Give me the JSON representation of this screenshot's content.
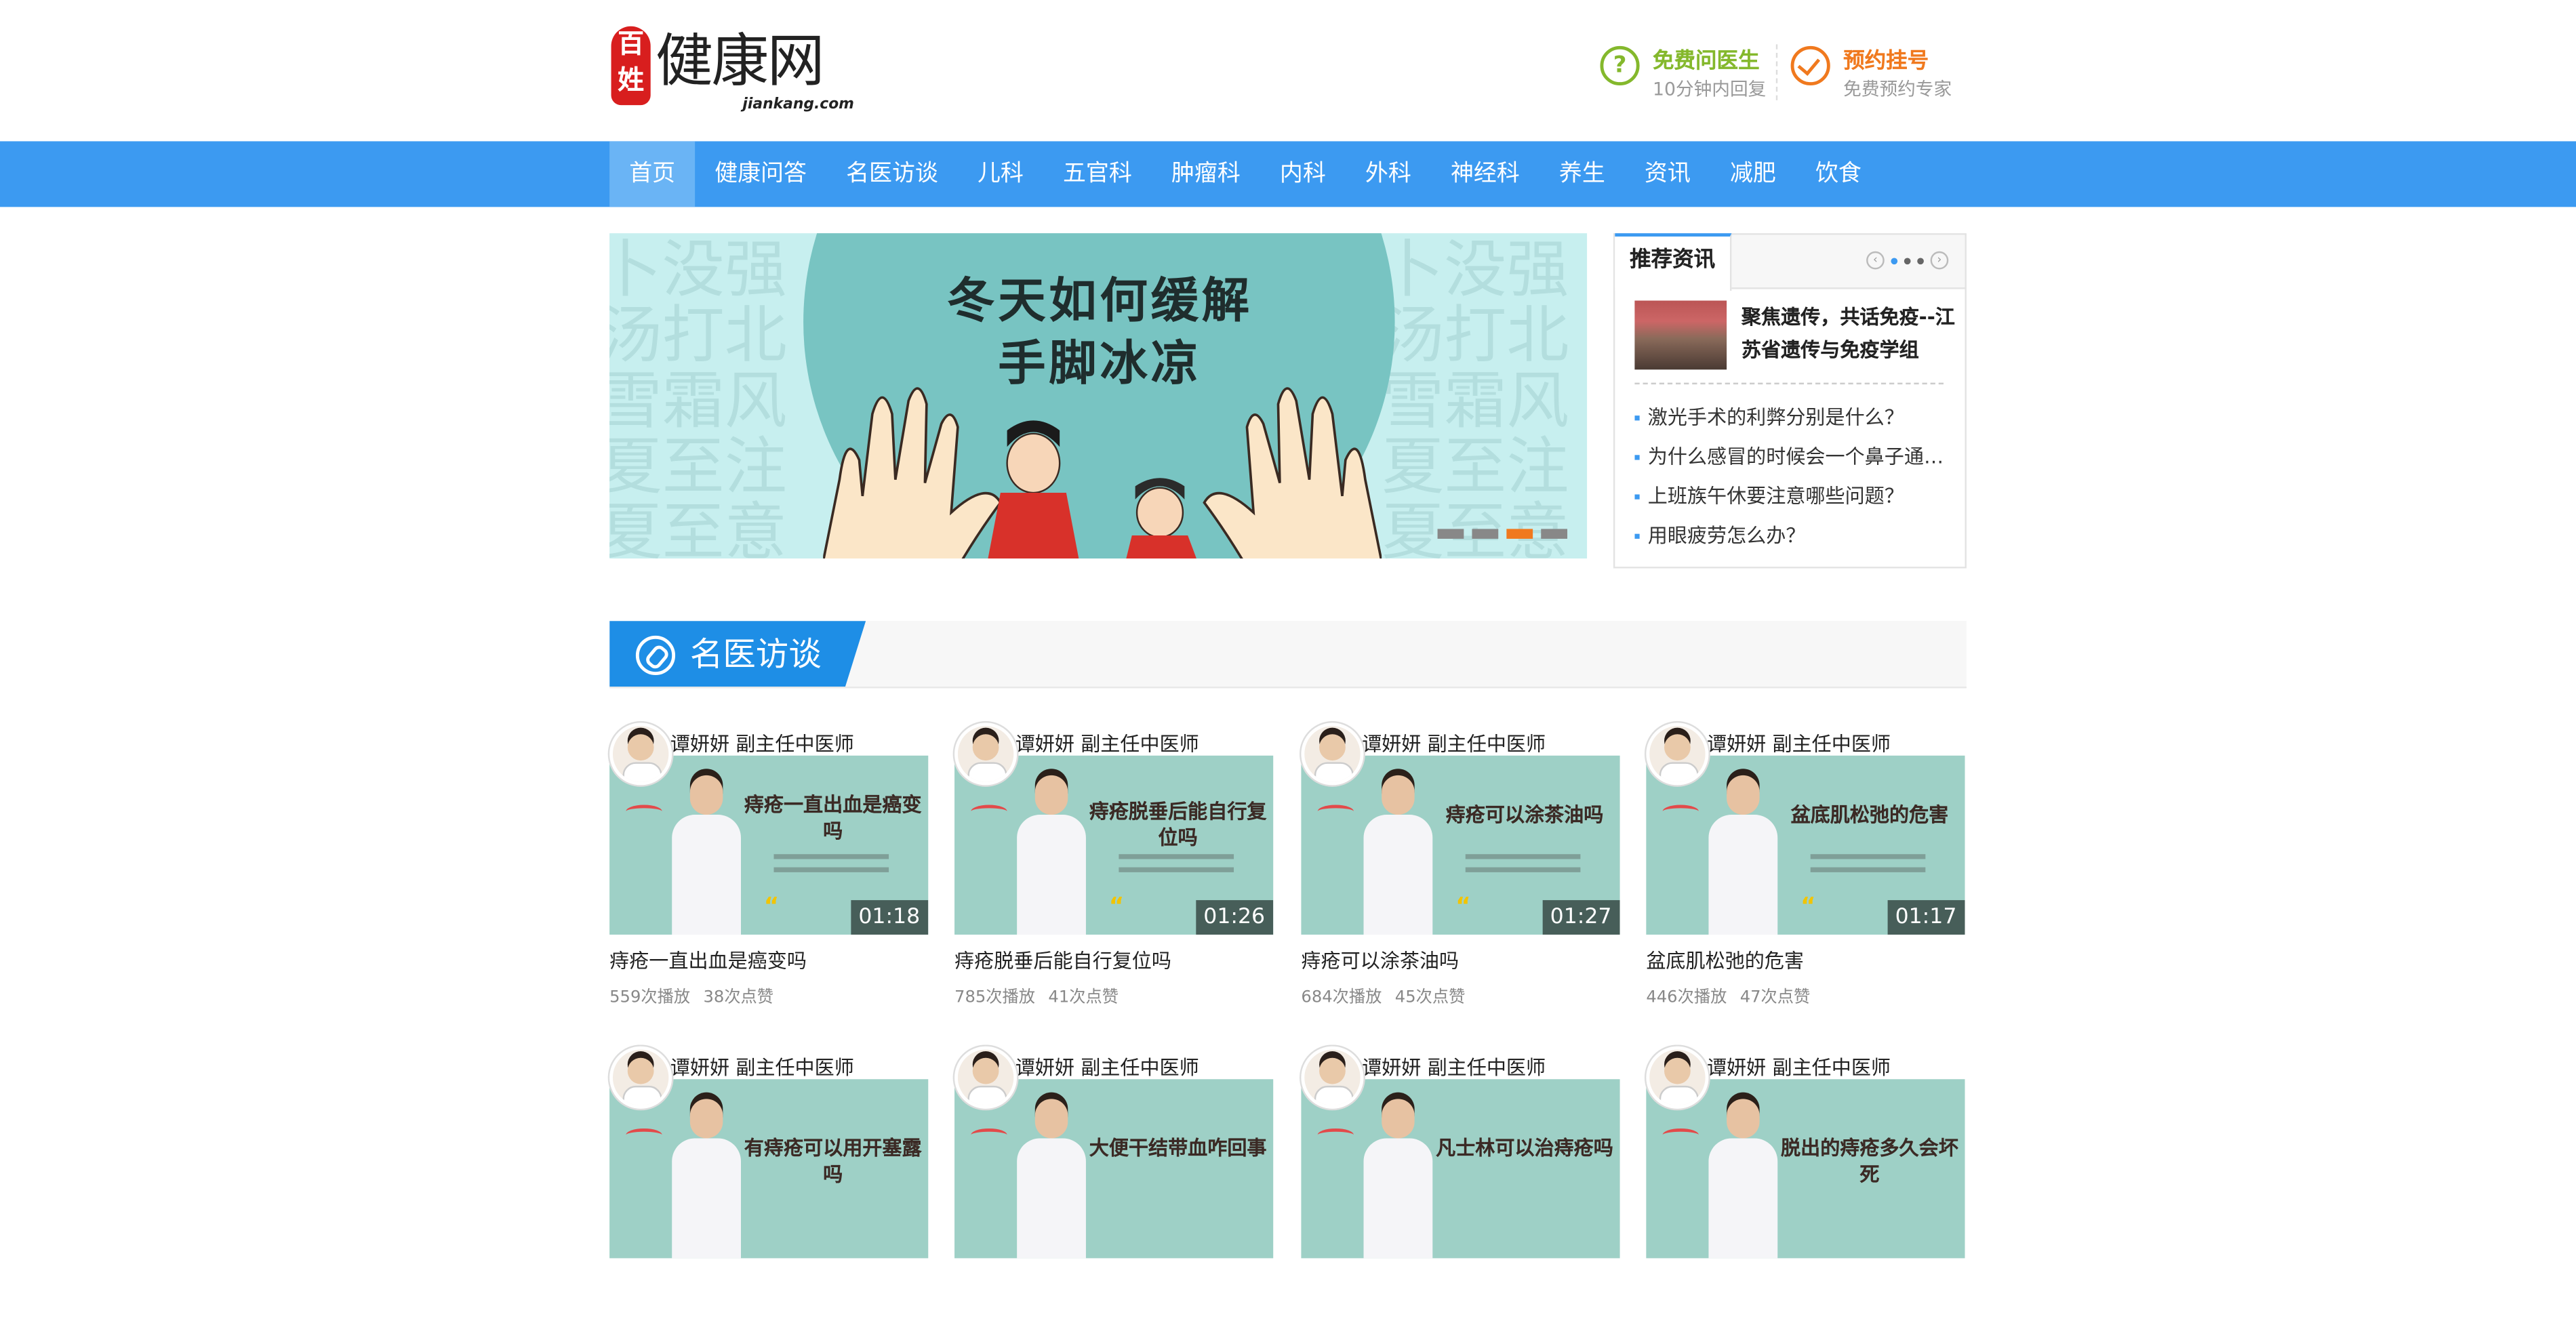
{
  "header": {
    "logo_seal": "百姓",
    "logo_brand": "健康网",
    "logo_domain": "jiankang.com",
    "ask": {
      "title": "免费问医生",
      "subtitle": "10分钟内回复",
      "color": "#84b82c",
      "icon": "question-icon"
    },
    "book": {
      "title": "预约挂号",
      "subtitle": "免费预约专家",
      "color": "#f0791e",
      "icon": "check-icon"
    }
  },
  "nav": {
    "color": "#3c9af1",
    "items": [
      "首页",
      "健康问答",
      "名医访谈",
      "儿科",
      "五官科",
      "肿瘤科",
      "内科",
      "外科",
      "神经科",
      "养生",
      "资讯",
      "减肥",
      "饮食"
    ],
    "active": "首页"
  },
  "banner": {
    "title_line1": "冬天如何缓解",
    "title_line2": "手脚冰凉",
    "bg_chars": "卜没强汤打北雪霜风夏至注夏至意 汉牛防"
  },
  "news": {
    "tab": "推荐资讯",
    "featured": "聚焦遗传，共话免疫--江苏省遗传与免疫学组",
    "items": [
      "激光手术的利弊分别是什么？",
      "为什么感冒的时候会一个鼻子通气一个鼻子不通",
      "上班族午休要注意哪些问题？",
      "用眼疲劳怎么办？"
    ]
  },
  "section": {
    "title": "名医访谈",
    "accent": "#1e8ee6"
  },
  "videos": [
    {
      "doctor": "谭妍妍 副主任中医师",
      "thumb_title": "痔疮一直出血是癌变吗",
      "duration": "01:18",
      "title": "痔疮一直出血是癌变吗",
      "plays": "559次播放",
      "likes": "38次点赞"
    },
    {
      "doctor": "谭妍妍 副主任中医师",
      "thumb_title": "痔疮脱垂后能自行复位吗",
      "duration": "01:26",
      "title": "痔疮脱垂后能自行复位吗",
      "plays": "785次播放",
      "likes": "41次点赞"
    },
    {
      "doctor": "谭妍妍 副主任中医师",
      "thumb_title": "痔疮可以涂茶油吗",
      "duration": "01:27",
      "title": "痔疮可以涂茶油吗",
      "plays": "684次播放",
      "likes": "45次点赞"
    },
    {
      "doctor": "谭妍妍 副主任中医师",
      "thumb_title": "盆底肌松弛的危害",
      "duration": "01:17",
      "title": "盆底肌松弛的危害",
      "plays": "446次播放",
      "likes": "47次点赞"
    },
    {
      "doctor": "谭妍妍 副主任中医师",
      "thumb_title": "有痔疮可以用开塞露吗"
    },
    {
      "doctor": "谭妍妍 副主任中医师",
      "thumb_title": "大便干结带血咋回事"
    },
    {
      "doctor": "谭妍妍 副主任中医师",
      "thumb_title": "凡士林可以治痔疮吗"
    },
    {
      "doctor": "谭妍妍 副主任中医师",
      "thumb_title": "脱出的痔疮多久会坏死"
    }
  ]
}
